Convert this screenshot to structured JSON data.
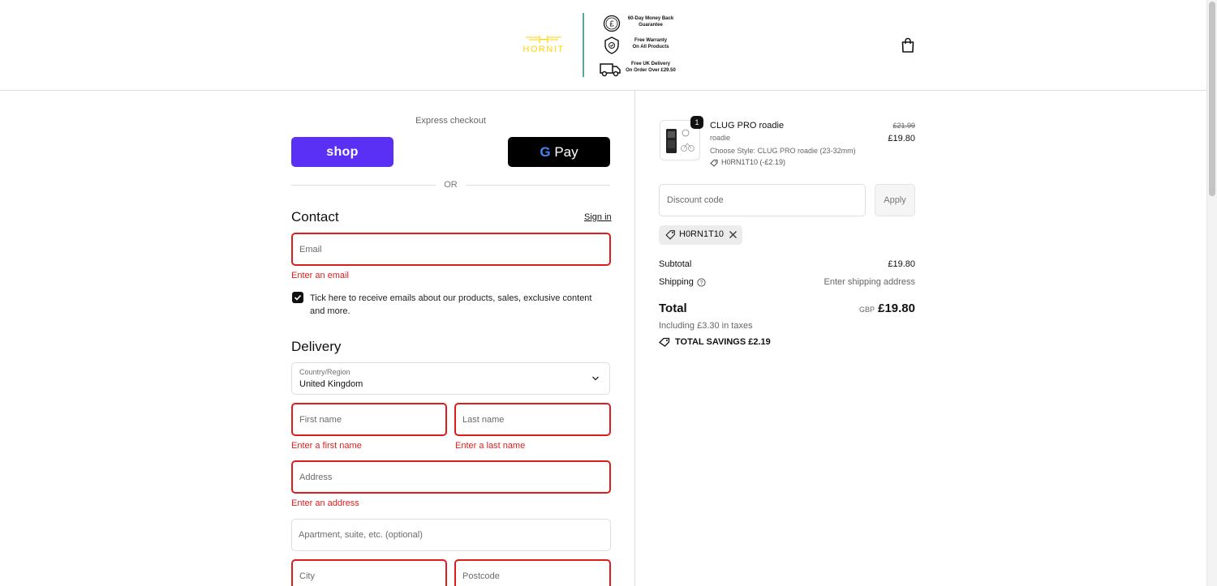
{
  "header": {
    "brand": "HORNIT",
    "perks": [
      {
        "icon": "pound-coin-icon",
        "line1": "60-Day Money Back",
        "line2": "Guarantee"
      },
      {
        "icon": "warranty-shield-icon",
        "line1": "Free Warranty",
        "line2": "On All Products"
      },
      {
        "icon": "delivery-truck-icon",
        "line1": "Free UK Delivery",
        "line2": "On Order Over £29.50"
      }
    ],
    "cart_icon": "shopping-bag-icon"
  },
  "express": {
    "title": "Express checkout",
    "shop_label": "shop",
    "gpay_g": "G",
    "gpay_label": "Pay",
    "or": "OR"
  },
  "contact": {
    "title": "Contact",
    "sign_in": "Sign in",
    "email_placeholder": "Email",
    "email_error": "Enter an email",
    "marketing_checked": true,
    "marketing_text": "Tick here to receive emails about our products, sales, exclusive content and more."
  },
  "delivery": {
    "title": "Delivery",
    "country_label": "Country/Region",
    "country_value": "United Kingdom",
    "first_name_placeholder": "First name",
    "first_name_error": "Enter a first name",
    "last_name_placeholder": "Last name",
    "last_name_error": "Enter a last name",
    "address_placeholder": "Address",
    "address_error": "Enter an address",
    "apartment_placeholder": "Apartment, suite, etc. (optional)",
    "city_placeholder": "City",
    "postcode_placeholder": "Postcode"
  },
  "summary": {
    "item": {
      "quantity": "1",
      "name": "CLUG PRO roadie",
      "variant": "roadie",
      "style": "Choose Style: CLUG PRO roadie (23-32mm)",
      "discount": "H0RN1T10 (-£2.19)",
      "price_original": "£21.99",
      "price": "£19.80"
    },
    "discount_placeholder": "Discount code",
    "apply_label": "Apply",
    "applied_code": "H0RN1T10",
    "subtotal_label": "Subtotal",
    "subtotal_value": "£19.80",
    "shipping_label": "Shipping",
    "shipping_value": "Enter shipping address",
    "total_label": "Total",
    "currency": "GBP",
    "total_value": "£19.80",
    "taxes_text": "Including £3.30 in taxes",
    "savings_text": "TOTAL SAVINGS  £2.19"
  },
  "colors": {
    "shop_purple": "#5a31f4",
    "error_red": "#dd1d1d",
    "brand_yellow": "#ffd400",
    "divider_teal": "#5aa69a"
  }
}
